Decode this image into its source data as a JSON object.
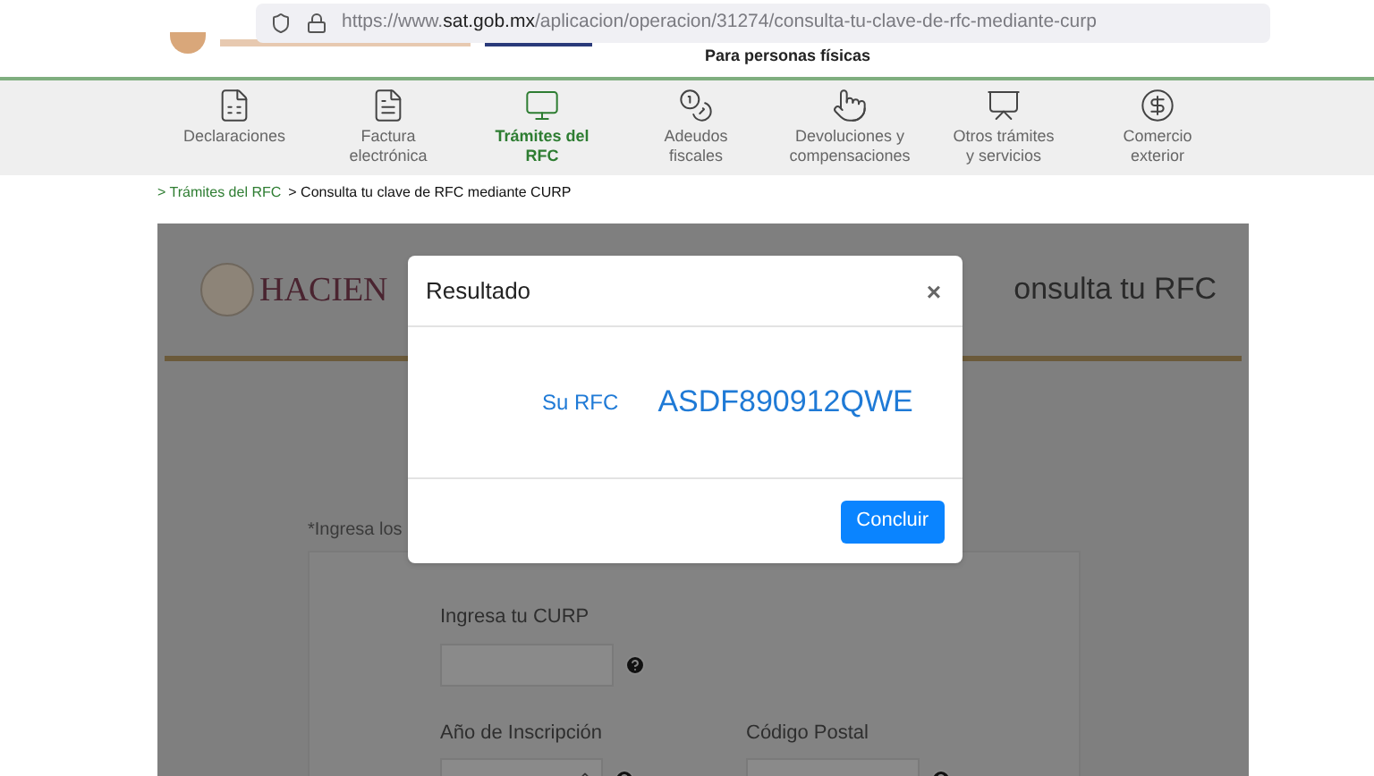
{
  "browser": {
    "url": "https://www.**sat.gob.mx**/aplicacion/operacion/31274/consulta-tu-clave-de-rfc-mediante-curp"
  },
  "header": {
    "subtitle": "Para personas físicas"
  },
  "nav": [
    {
      "label": "Declaraciones",
      "selected": false
    },
    {
      "label": "Factura\nelectrónica",
      "selected": false
    },
    {
      "label": "Trámites del\nRFC",
      "selected": true
    },
    {
      "label": "Adeudos\nfiscales",
      "selected": false
    },
    {
      "label": "Devoluciones y\ncompensaciones",
      "selected": false
    },
    {
      "label": "Otros trámites\ny servicios",
      "selected": false
    },
    {
      "label": "Comercio\nexterior",
      "selected": false
    }
  ],
  "breadcrumb": [
    {
      "label": "> Trámites del RFC",
      "kind": "link"
    },
    {
      "label": "> Consulta tu clave de RFC mediante CURP",
      "kind": "current"
    }
  ],
  "page": {
    "logo_text": "HACIEN",
    "title": "onsulta tu RFC",
    "instructions": "*Ingresa los",
    "fields": [
      {
        "label": "Ingresa tu CURP",
        "kind": "text"
      },
      {
        "label": "Año de Inscripción",
        "kind": "select"
      },
      {
        "label": "Código Postal",
        "kind": "text"
      }
    ]
  },
  "modal": {
    "title": "Resultado",
    "close": "×",
    "result_label": "Su RFC",
    "result_value": "ASDF890912QWE",
    "button": "Concluir"
  }
}
